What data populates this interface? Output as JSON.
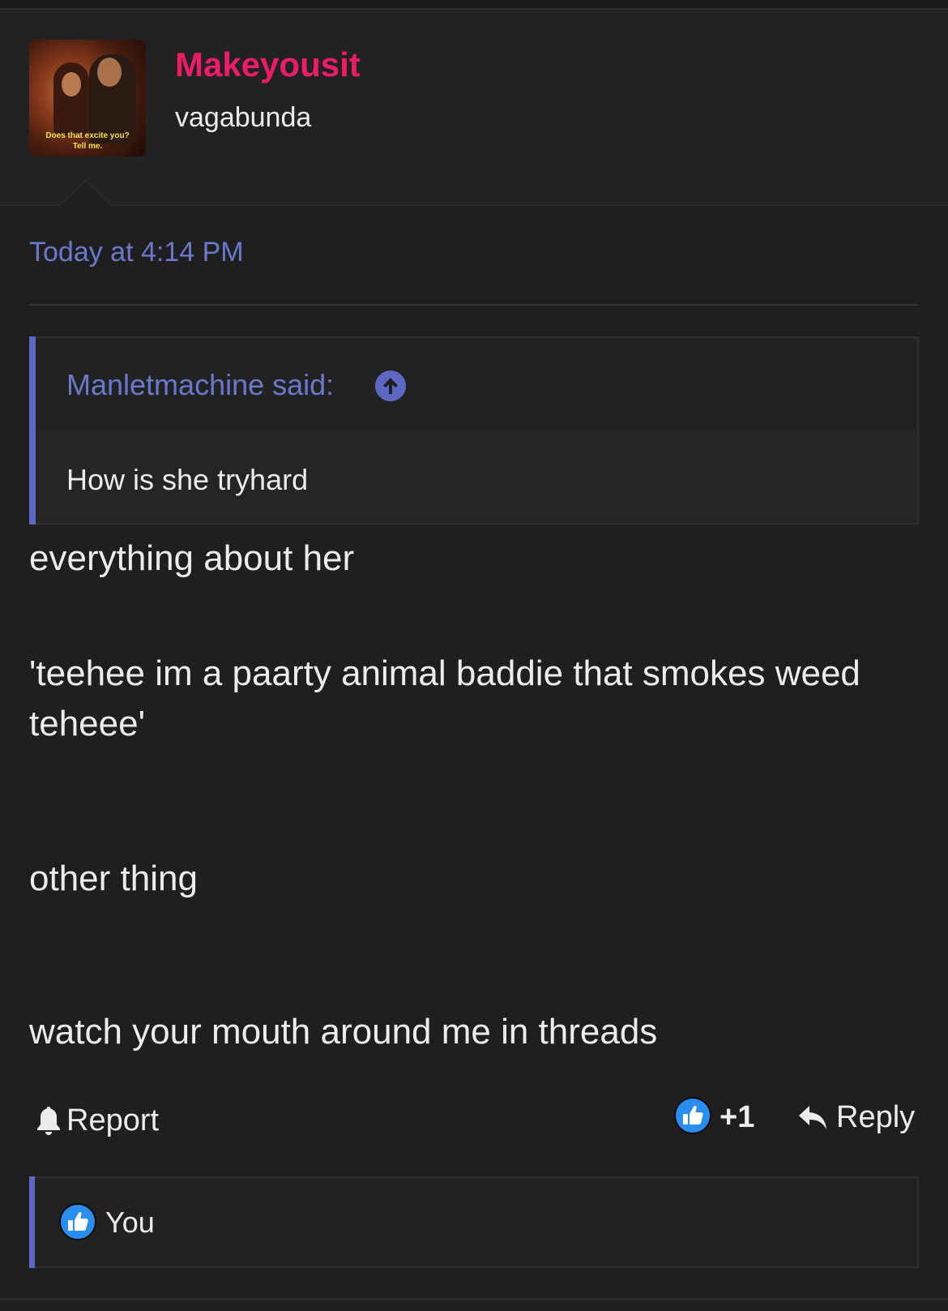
{
  "post": {
    "author": "Makeyousit",
    "user_title": "vagabunda",
    "avatar_caption_line1": "Does that excite you?",
    "avatar_caption_line2": "Tell me.",
    "timestamp": "Today at 4:14 PM",
    "quote": {
      "author_label": "Manletmachine said:",
      "text": "How is she tryhard"
    },
    "body": {
      "line1": "everything about her",
      "line2": "'teehee im a paarty animal baddie that smokes weed",
      "line3": "teheee'",
      "line4": "other thing",
      "line5": "watch your mouth around me in threads"
    },
    "actions": {
      "report_label": "Report",
      "like_count": "+1",
      "reply_label": "Reply"
    },
    "likes": {
      "name": "You"
    }
  },
  "colors": {
    "background": "#1f1f1f",
    "username": "#ec1c68",
    "link_blue": "#6a79cc",
    "quote_bar": "#5c68c4",
    "like_blue": "#2a8ef0"
  },
  "icons": {
    "quote_jump": "arrow-up-circle-icon",
    "report": "bell-icon",
    "like": "thumbs-up-icon",
    "reply": "reply-arrow-icon"
  }
}
